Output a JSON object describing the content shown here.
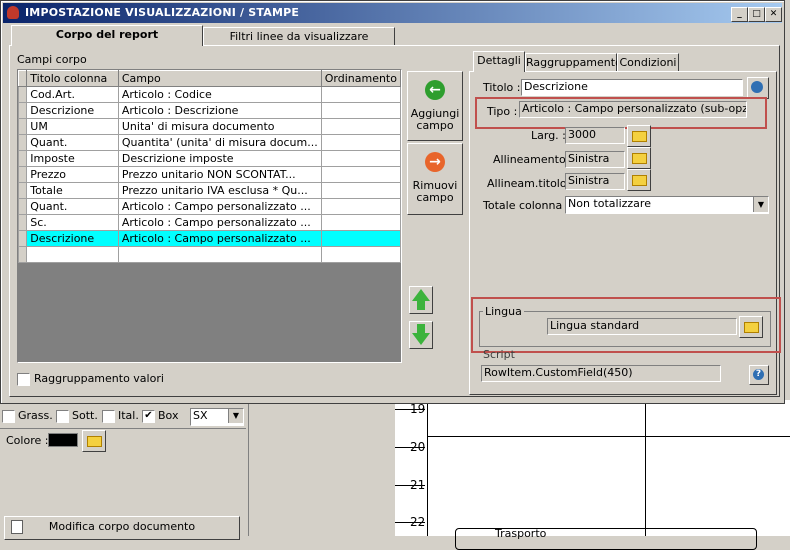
{
  "window": {
    "title": "IMPOSTAZIONE VISUALIZZAZIONI / STAMPE"
  },
  "tabs": [
    {
      "label": "Corpo del report"
    },
    {
      "label": "Filtri linee da visualizzare"
    }
  ],
  "grid": {
    "group_label": "Campi corpo",
    "headers": [
      "Titolo colonna",
      "Campo",
      "Ordinamento"
    ],
    "rows": [
      {
        "titolo": "Cod.Art.",
        "campo": "Articolo : Codice",
        "ord": ""
      },
      {
        "titolo": "Descrizione",
        "campo": "Articolo : Descrizione",
        "ord": ""
      },
      {
        "titolo": "UM",
        "campo": "Unita' di misura documento",
        "ord": ""
      },
      {
        "titolo": "Quant.",
        "campo": "Quantita' (unita' di misura docum...",
        "ord": ""
      },
      {
        "titolo": "Imposte",
        "campo": "Descrizione imposte",
        "ord": ""
      },
      {
        "titolo": "Prezzo",
        "campo": "Prezzo unitario NON SCONTAT...",
        "ord": ""
      },
      {
        "titolo": "Totale",
        "campo": "Prezzo unitario IVA esclusa * Qu...",
        "ord": ""
      },
      {
        "titolo": "Quant.",
        "campo": "Articolo : Campo personalizzato ...",
        "ord": ""
      },
      {
        "titolo": "Sc.",
        "campo": "Articolo : Campo personalizzato ...",
        "ord": ""
      },
      {
        "titolo": "Descrizione",
        "campo": "Articolo : Campo personalizzato ...",
        "ord": ""
      }
    ]
  },
  "buttons": {
    "add": "Aggiungi campo",
    "remove": "Rimuovi campo"
  },
  "raggruppamento_valori": "Raggruppamento valori",
  "right_tabs": [
    {
      "label": "Dettagli"
    },
    {
      "label": "Raggruppamento"
    },
    {
      "label": "Condizioni"
    }
  ],
  "details": {
    "titolo_label": "Titolo :",
    "titolo_value": "Descrizione",
    "tipo_label": "Tipo :",
    "tipo_value": "Articolo : Campo personalizzato (sub-opzione)",
    "larg_label": "Larg. :",
    "larg_value": "3000",
    "allineamento_label": "Allineamento :",
    "allineamento_value": "Sinistra",
    "allineam_titolo_label": "Allineam.titolo :",
    "allineam_titolo_value": "Sinistra",
    "totale_label": "Totale colonna :",
    "totale_value": "Non totalizzare",
    "lingua_label": "Lingua",
    "lingua_value": "Lingua standard",
    "script_label": "Script",
    "script_value": "RowItem.CustomField(450)"
  },
  "background": {
    "grass": "Grass.",
    "sott": "Sott.",
    "ital": "Ital.",
    "box": "Box",
    "align": "SX",
    "colore": "Colore :",
    "modifica": "Modifica corpo documento",
    "ruler": [
      "19",
      "20",
      "21",
      "22"
    ],
    "trasporto": "Trasporto"
  },
  "colors": {
    "selected_row": "#00ffff",
    "highlight_box": "#c0504d",
    "title_bar": "#0a246a"
  }
}
